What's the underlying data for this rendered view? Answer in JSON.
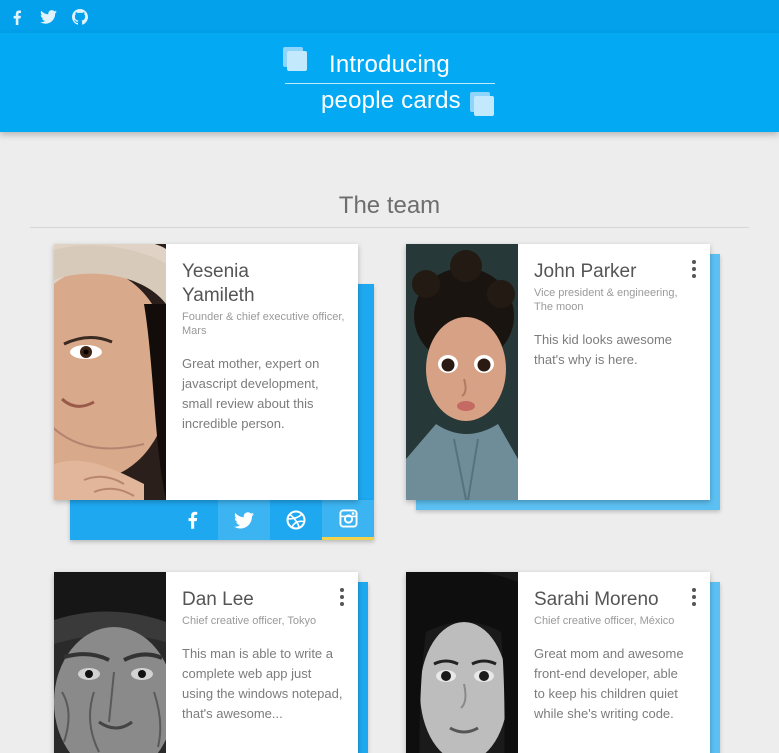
{
  "colors": {
    "topbar": "#03a0ec",
    "header": "#04a9f4",
    "card_accent": "#1ea8f0",
    "card_accent_light": "#5cc0f2",
    "instagram_underline": "#f3d34a"
  },
  "topbar": {
    "icons": [
      "facebook-icon",
      "twitter-icon",
      "github-icon"
    ]
  },
  "header": {
    "line1": "Introducing",
    "line2": "people cards"
  },
  "section": {
    "title": "The team"
  },
  "cards": [
    {
      "name": "Yesenia Yamileth",
      "role": "Founder & chief executive officer, Mars",
      "description": "Great mother, expert on javascript development, small review about this incredible person.",
      "photo": "woman-portrait-color",
      "social": [
        "facebook-icon",
        "twitter-icon",
        "dribbble-icon",
        "instagram-icon"
      ]
    },
    {
      "name": "John Parker",
      "role": "Vice president & engineering, The moon",
      "description": "This kid looks awesome that's why is here.",
      "photo": "child-portrait-color"
    },
    {
      "name": "Dan Lee",
      "role": "Chief creative officer, Tokyo",
      "description": "This man is able to write a complete web app just using the windows notepad, that's awesome...",
      "photo": "old-man-portrait-bw"
    },
    {
      "name": "Sarahi Moreno",
      "role": "Chief creative officer, México",
      "description": "Great mom and awesome front-end developer, able to keep his children quiet while she's writing code.",
      "photo": "woman-portrait-bw"
    }
  ]
}
